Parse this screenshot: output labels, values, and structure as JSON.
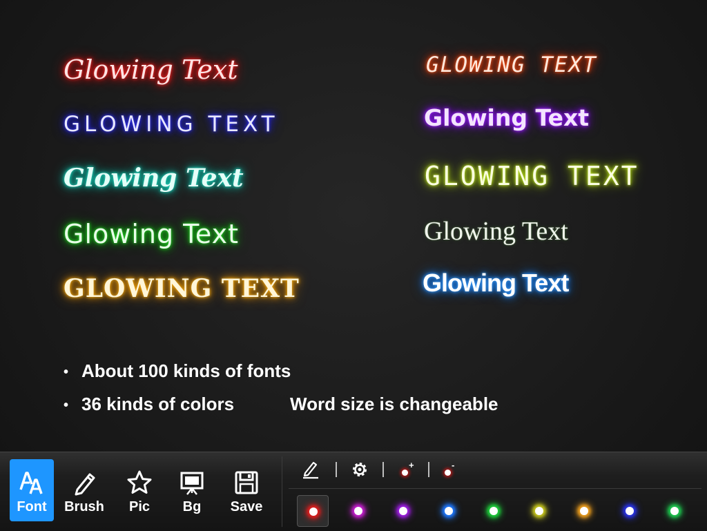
{
  "samples": {
    "left": [
      "Glowing Text",
      "GLOWING TEXT",
      "Glowing Text",
      "Glowing Text",
      "GLOWING TEXT"
    ],
    "right": [
      "GLOWING TEXT",
      "Glowing Text",
      "GLOWING TEXT",
      "Glowing Text",
      "Glowing Text"
    ],
    "colors": {
      "red": "#ff1414",
      "blue": "#2222ff",
      "teal": "#10c8b0",
      "green": "#14c814",
      "gold": "#f09a00",
      "orange": "#ff3c00",
      "purple": "#8c10ff",
      "lime": "#b4dc10",
      "olive": "#2a4024",
      "sky": "#1e86ff"
    }
  },
  "features": {
    "bullet": "•",
    "fonts": "About 100 kinds of fonts",
    "colors": "36 kinds of colors",
    "size": "Word size is changeable"
  },
  "toolbar": {
    "active_color": "#1e96ff",
    "tools": [
      {
        "label": "Font",
        "icon": "font-icon",
        "active": true
      },
      {
        "label": "Brush",
        "icon": "brush-icon",
        "active": false
      },
      {
        "label": "Pic",
        "icon": "star-icon",
        "active": false
      },
      {
        "label": "Bg",
        "icon": "easel-icon",
        "active": false
      },
      {
        "label": "Save",
        "icon": "floppy-disk-icon",
        "active": false
      }
    ],
    "controls": [
      {
        "icon": "pencil-underline-icon"
      },
      {
        "icon": "gear-icon"
      },
      {
        "icon": "glow-plus-icon",
        "sup": "+"
      },
      {
        "icon": "glow-minus-icon",
        "sup": "-"
      }
    ],
    "swatches": [
      {
        "color": "#e01e1e",
        "selected": true
      },
      {
        "color": "#c81ed2",
        "selected": false
      },
      {
        "color": "#a01ee6",
        "selected": false
      },
      {
        "color": "#1e78ff",
        "selected": false
      },
      {
        "color": "#1ed23c",
        "selected": false
      },
      {
        "color": "#c8c81e",
        "selected": false
      },
      {
        "color": "#f0a01e",
        "selected": false
      },
      {
        "color": "#2832e6",
        "selected": false
      },
      {
        "color": "#1ecc50",
        "selected": false
      }
    ]
  }
}
